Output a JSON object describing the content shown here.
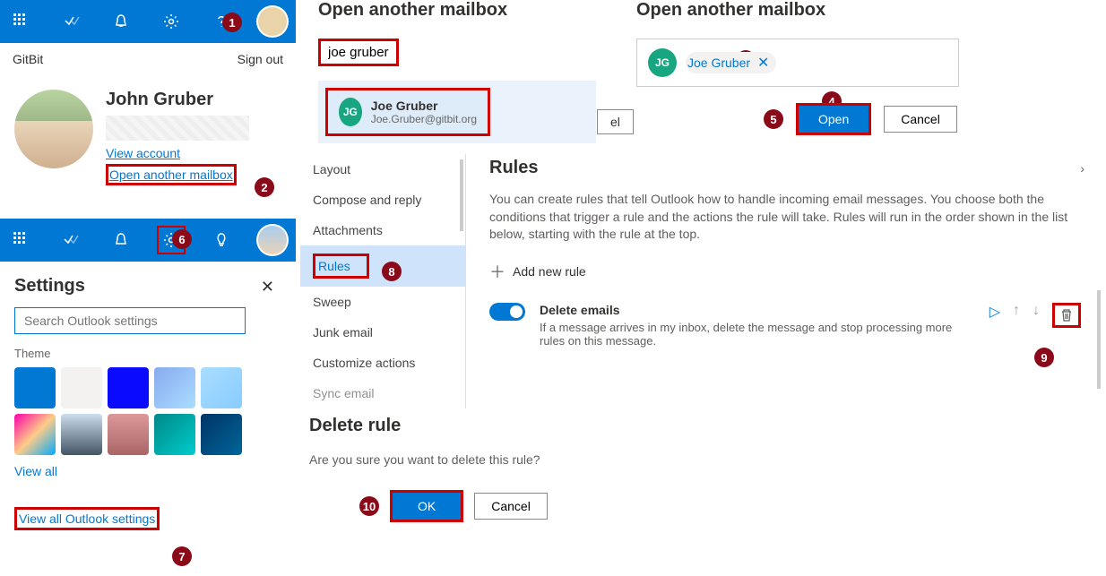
{
  "header": {
    "app": "GitBit",
    "sign_out": "Sign out"
  },
  "profile": {
    "name": "John Gruber",
    "view_account": "View account",
    "open_mailbox": "Open another mailbox"
  },
  "settings_panel": {
    "title": "Settings",
    "search_placeholder": "Search Outlook settings",
    "theme_label": "Theme",
    "view_all": "View all",
    "view_all_settings": "View all Outlook settings"
  },
  "mailbox_left": {
    "title": "Open another mailbox",
    "input_value": "joe gruber",
    "suggestion_initials": "JG",
    "suggestion_name": "Joe Gruber",
    "suggestion_email": "Joe.Gruber@gitbit.org",
    "cancel": "el"
  },
  "mailbox_right": {
    "title": "Open another mailbox",
    "chip_initials": "JG",
    "chip_name": "Joe Gruber",
    "open": "Open",
    "cancel": "Cancel"
  },
  "settings_menu": {
    "items": [
      "Layout",
      "Compose and reply",
      "Attachments",
      "Rules",
      "Sweep",
      "Junk email",
      "Customize actions",
      "Sync email"
    ]
  },
  "rules": {
    "title": "Rules",
    "desc": "You can create rules that tell Outlook how to handle incoming email messages. You choose both the conditions that trigger a rule and the actions the rule will take. Rules will run in the order shown in the list below, starting with the rule at the top.",
    "add": "Add new rule",
    "rule_name": "Delete emails",
    "rule_desc": "If a message arrives in my inbox, delete the message and stop processing more rules on this message."
  },
  "delete_rule": {
    "title": "Delete rule",
    "question": "Are you sure you want to delete this rule?",
    "ok": "OK",
    "cancel": "Cancel"
  },
  "badges": [
    "1",
    "2",
    "3",
    "4",
    "5",
    "6",
    "7",
    "8",
    "9",
    "10"
  ]
}
